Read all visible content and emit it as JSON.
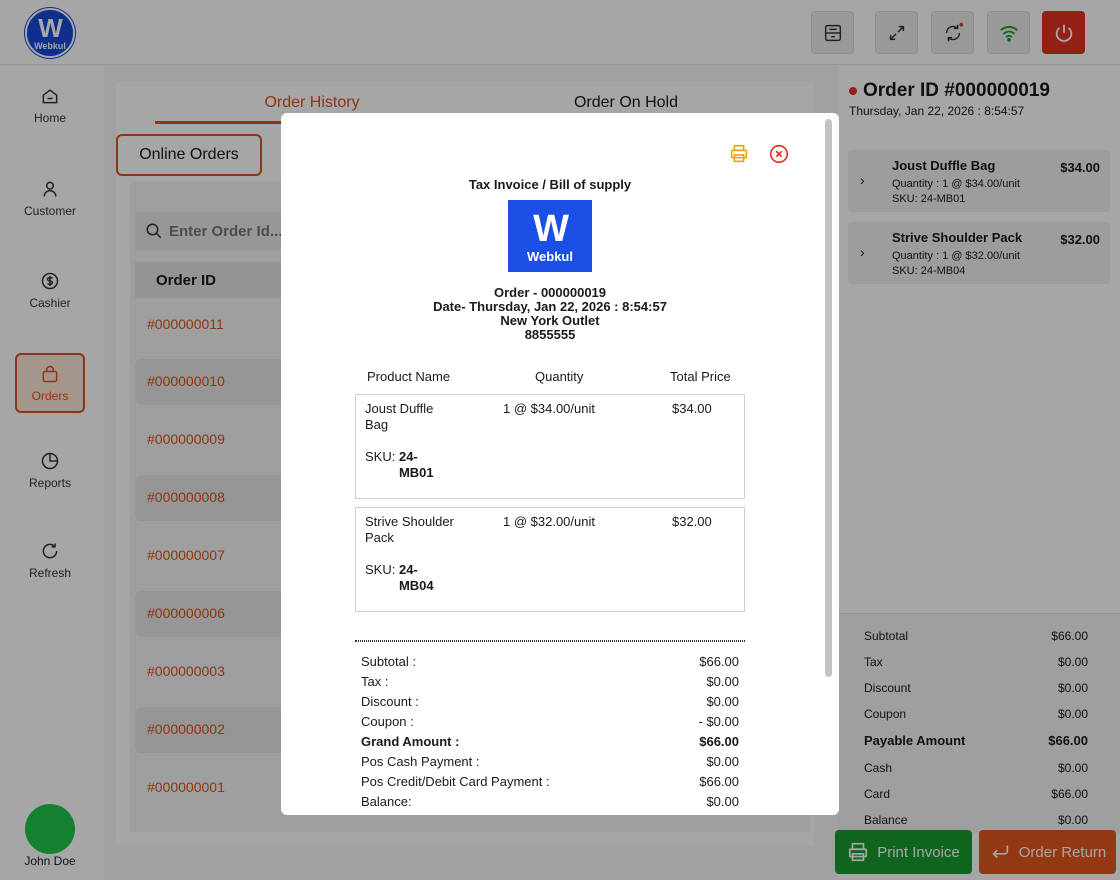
{
  "brand": {
    "logo_text": "Webkul"
  },
  "sidebar": {
    "items": [
      {
        "label": "Home",
        "icon": "home-icon"
      },
      {
        "label": "Customer",
        "icon": "user-icon"
      },
      {
        "label": "Cashier",
        "icon": "dollar-icon"
      },
      {
        "label": "Orders",
        "icon": "bag-icon"
      },
      {
        "label": "Reports",
        "icon": "pie-chart-icon"
      },
      {
        "label": "Refresh",
        "icon": "refresh-icon"
      }
    ],
    "user": "John Doe"
  },
  "main": {
    "tabs": [
      "Order History",
      "Order On Hold"
    ],
    "online_orders_label": "Online Orders",
    "search_placeholder": "Enter Order Id...",
    "column_header": "Order ID",
    "orders": [
      "#000000011",
      "#000000010",
      "#000000009",
      "#000000008",
      "#000000007",
      "#000000006",
      "#000000003",
      "#000000002",
      "#000000001"
    ]
  },
  "order": {
    "title": "Order ID #000000019",
    "date": "Thursday, Jan 22, 2026 : 8:54:57",
    "items": [
      {
        "name": "Joust Duffle Bag",
        "qty": "Quantity : 1 @ $34.00/unit",
        "sku": "SKU: 24-MB01",
        "price": "$34.00"
      },
      {
        "name": "Strive Shoulder Pack",
        "qty": "Quantity : 1 @ $32.00/unit",
        "sku": "SKU: 24-MB04",
        "price": "$32.00"
      }
    ],
    "summary": [
      {
        "label": "Subtotal",
        "value": "$66.00"
      },
      {
        "label": "Tax",
        "value": "$0.00"
      },
      {
        "label": "Discount",
        "value": "$0.00"
      },
      {
        "label": "Coupon",
        "value": "$0.00"
      },
      {
        "label": "Payable Amount",
        "value": "$66.00"
      },
      {
        "label": "Cash",
        "value": "$0.00"
      },
      {
        "label": "Card",
        "value": "$66.00"
      },
      {
        "label": "Balance",
        "value": "$0.00"
      }
    ],
    "print_label": "Print Invoice",
    "return_label": "Order Return"
  },
  "invoice": {
    "title": "Tax Invoice / Bill of supply",
    "logo_text": "Webkul",
    "order_line": "Order - 000000019",
    "date_line": "Date- Thursday, Jan 22, 2026 : 8:54:57",
    "outlet": "New York Outlet",
    "phone": "8855555",
    "headers": [
      "Product Name",
      "Quantity",
      "Total Price"
    ],
    "items": [
      {
        "name": "Joust Duffle Bag",
        "sku_label": "SKU:",
        "sku": "24-MB01",
        "qty": "1 @ $34.00/unit",
        "total": "$34.00"
      },
      {
        "name": "Strive Shoulder Pack",
        "sku_label": "SKU:",
        "sku": "24-MB04",
        "qty": "1 @ $32.00/unit",
        "total": "$32.00"
      }
    ],
    "totals": [
      {
        "label": "Subtotal :",
        "value": "$66.00"
      },
      {
        "label": "Tax :",
        "value": "$0.00"
      },
      {
        "label": "Discount :",
        "value": "$0.00"
      },
      {
        "label": "Coupon :",
        "value": "- $0.00"
      },
      {
        "label": "Grand Amount :",
        "value": "$66.00"
      },
      {
        "label": "Pos Cash Payment :",
        "value": "$0.00"
      },
      {
        "label": "Pos Credit/Debit Card Payment :",
        "value": "$66.00"
      },
      {
        "label": "Balance:",
        "value": "$0.00"
      }
    ]
  },
  "colors": {
    "accent": "#d9541e",
    "brand": "#1c4fe6",
    "success": "#1a9c2e",
    "danger": "#e53222"
  }
}
